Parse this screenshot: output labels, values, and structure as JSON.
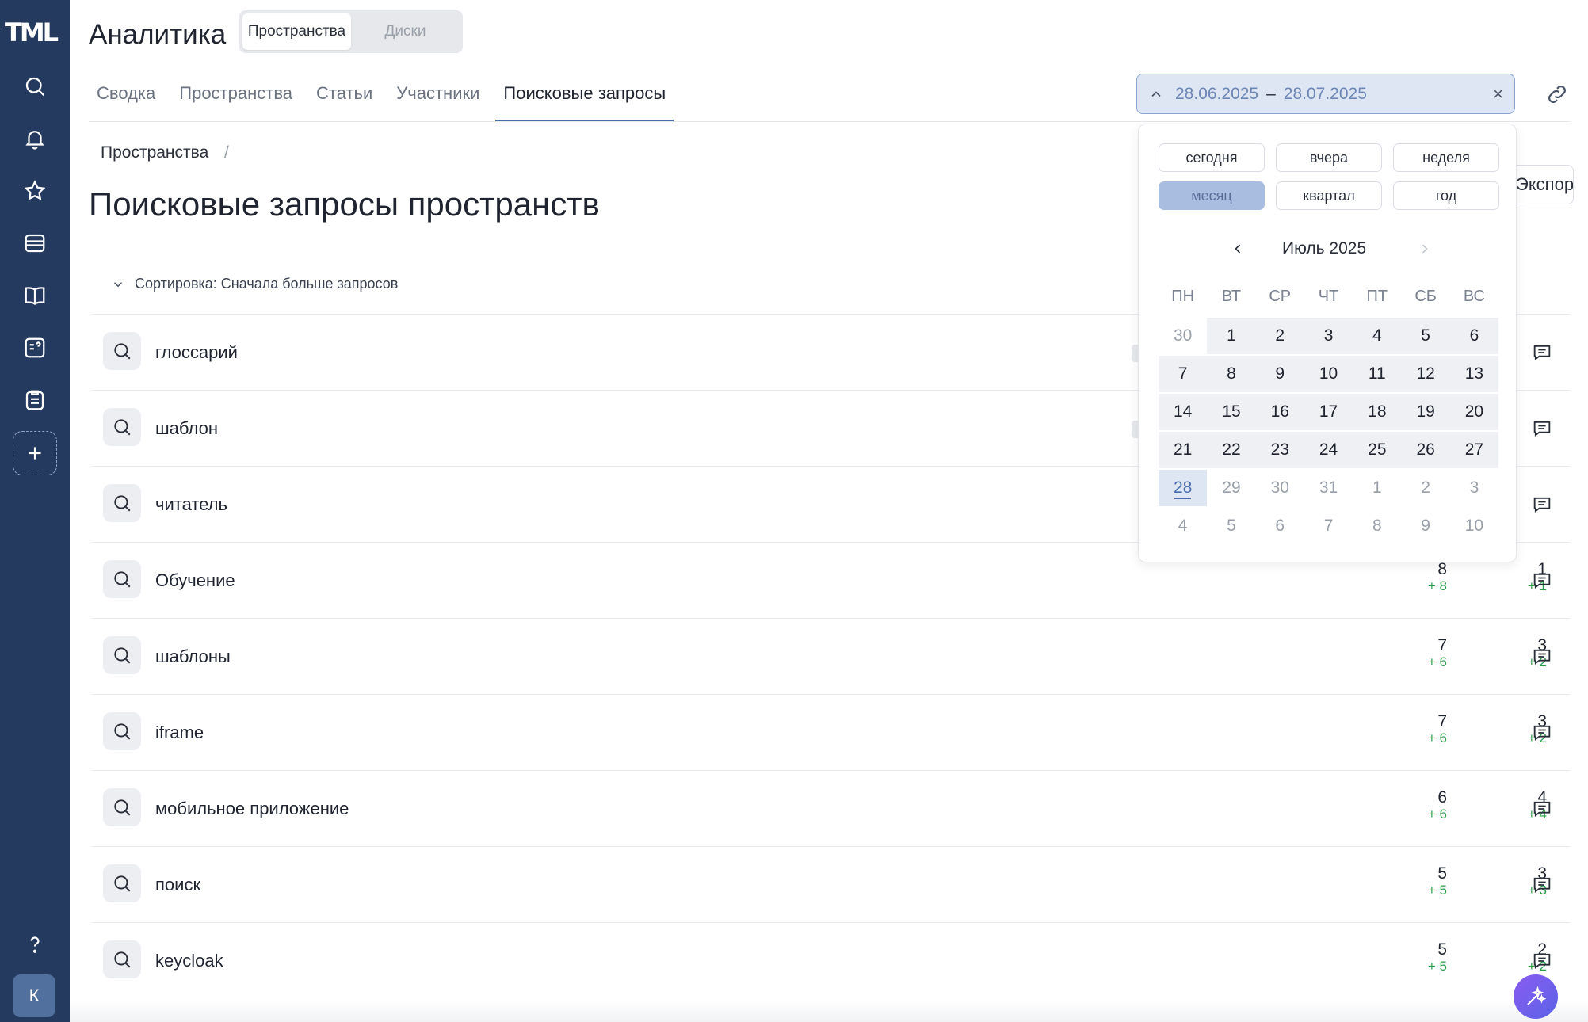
{
  "logo": "TML",
  "app_title": "Аналитика",
  "segments": [
    "Пространства",
    "Диски"
  ],
  "tabs": [
    "Сводка",
    "Пространства",
    "Статьи",
    "Участники",
    "Поисковые запросы"
  ],
  "active_tab": "Поисковые запросы",
  "date_range": {
    "from": "28.06.2025",
    "dash": "–",
    "to": "28.07.2025",
    "clear": "×"
  },
  "breadcrumb": {
    "item": "Пространства",
    "sep": "/"
  },
  "page_title": "Поисковые запросы пространств",
  "export_label": "Экспорт",
  "sort_label": "Сортировка: Сначала больше запросов",
  "avatar": "К",
  "queries": [
    {
      "name": "глоссарий",
      "c1": "",
      "c1d": "",
      "c2": "",
      "c2d": ""
    },
    {
      "name": "шаблон",
      "c1": "",
      "c1d": "",
      "c2": "",
      "c2d": ""
    },
    {
      "name": "читатель",
      "c1": "",
      "c1d": "",
      "c2": "",
      "c2d": ""
    },
    {
      "name": "Обучение",
      "c1": "8",
      "c1d": "+ 8",
      "c2": "1",
      "c2d": "+ 1"
    },
    {
      "name": "шаблоны",
      "c1": "7",
      "c1d": "+ 6",
      "c2": "3",
      "c2d": "+ 2"
    },
    {
      "name": "iframe",
      "c1": "7",
      "c1d": "+ 6",
      "c2": "3",
      "c2d": "+ 2"
    },
    {
      "name": "мобильное приложение",
      "c1": "6",
      "c1d": "+ 6",
      "c2": "4",
      "c2d": "+ 4"
    },
    {
      "name": "поиск",
      "c1": "5",
      "c1d": "+ 5",
      "c2": "3",
      "c2d": "+ 3"
    },
    {
      "name": "keycloak",
      "c1": "5",
      "c1d": "+ 5",
      "c2": "2",
      "c2d": "+ 2"
    }
  ],
  "calendar": {
    "presets": [
      "сегодня",
      "вчера",
      "неделя",
      "месяц",
      "квартал",
      "год"
    ],
    "active_preset": "месяц",
    "month": "Июль 2025",
    "weekdays": [
      "ПН",
      "ВТ",
      "СР",
      "ЧТ",
      "ПТ",
      "СБ",
      "ВС"
    ],
    "weeks": [
      [
        "30",
        "1",
        "2",
        "3",
        "4",
        "5",
        "6"
      ],
      [
        "7",
        "8",
        "9",
        "10",
        "11",
        "12",
        "13"
      ],
      [
        "14",
        "15",
        "16",
        "17",
        "18",
        "19",
        "20"
      ],
      [
        "21",
        "22",
        "23",
        "24",
        "25",
        "26",
        "27"
      ],
      [
        "28",
        "29",
        "30",
        "31",
        "1",
        "2",
        "3"
      ],
      [
        "4",
        "5",
        "6",
        "7",
        "8",
        "9",
        "10"
      ]
    ],
    "selected_day": "28"
  },
  "colors": {
    "sidebar": "#243a5e",
    "accent": "#4a6db0",
    "delta": "#2a9d4a"
  }
}
